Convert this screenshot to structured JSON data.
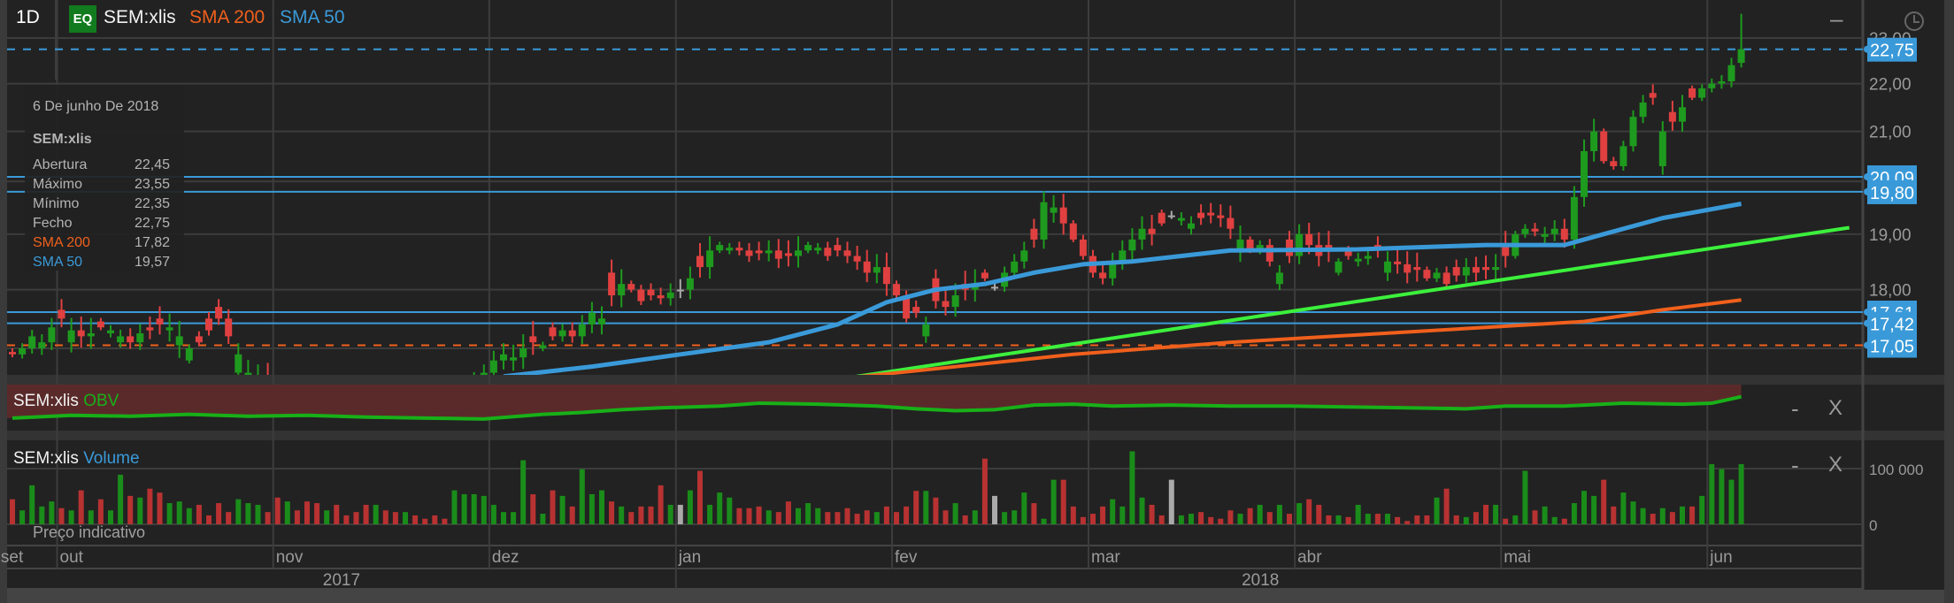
{
  "header": {
    "interval": "1D",
    "badge": "EQ",
    "symbol": "SEM:xlis",
    "sma200_label": "SMA 200",
    "sma50_label": "SMA 50"
  },
  "tooltip": {
    "date": "6 De junho De 2018",
    "symbol": "SEM:xlis",
    "rows": [
      {
        "label": "Abertura",
        "value": "22,45"
      },
      {
        "label": "Máximo",
        "value": "23,55"
      },
      {
        "label": "Mínimo",
        "value": "22,35"
      },
      {
        "label": "Fecho",
        "value": "22,75"
      },
      {
        "label": "SMA 200",
        "value": "17,82"
      },
      {
        "label": "SMA 50",
        "value": "19,57"
      }
    ]
  },
  "panels": {
    "obv": {
      "symbol": "SEM:xlis",
      "name": "OBV",
      "minimize": "-",
      "close": "X"
    },
    "volume": {
      "symbol": "SEM:xlis",
      "name": "Volume",
      "minimize": "-",
      "close": "X"
    },
    "price_minimize": "–"
  },
  "footer_note": "Preço indicativo",
  "colors": {
    "up": "#1e9a1e",
    "down": "#e04040",
    "neutral": "#aaaaaa",
    "sma200": "#f0601c",
    "sma50": "#3a9ad9",
    "trend": "#3cf03c",
    "obv": "#18b018",
    "obv_fill": "#5a2a2a",
    "tag": "#3a9ad9"
  },
  "chart_data": {
    "type": "candlestick",
    "scale": "log",
    "ylim": [
      16.47,
      23.4
    ],
    "y_ticks": [
      {
        "v": 23,
        "label": "23,00"
      },
      {
        "v": 22,
        "label": "22,00"
      },
      {
        "v": 21,
        "label": "21,00"
      },
      {
        "v": 19,
        "label": "19,00"
      },
      {
        "v": 18,
        "label": "18,00"
      }
    ],
    "price_tags": [
      {
        "v": 22.75,
        "label": "22,75",
        "style": "dashed-blue"
      },
      {
        "v": 20.09,
        "label": "20,09",
        "style": "solid-blue"
      },
      {
        "v": 19.8,
        "label": "19,80",
        "style": "solid-blue"
      },
      {
        "v": 17.61,
        "label": "17,61",
        "style": "solid-blue"
      },
      {
        "v": 17.42,
        "label": "17,42",
        "style": "solid-blue"
      },
      {
        "v": 17.05,
        "label": "17,05",
        "style": "dashed-orange"
      }
    ],
    "months": [
      {
        "label": "set",
        "day": -1
      },
      {
        "label": "out",
        "day": 5
      },
      {
        "label": "nov",
        "day": 27
      },
      {
        "label": "dez",
        "day": 49
      },
      {
        "label": "jan",
        "day": 68
      },
      {
        "label": "fev",
        "day": 90
      },
      {
        "label": "mar",
        "day": 110
      },
      {
        "label": "abr",
        "day": 131
      },
      {
        "label": "mai",
        "day": 152
      },
      {
        "label": "jun",
        "day": 173
      }
    ],
    "years": [
      {
        "label": "2017",
        "from": -1,
        "to": 68
      },
      {
        "label": "2018",
        "from": 68,
        "to": 187
      }
    ],
    "close": [
      16.9,
      17.0,
      17.2,
      17.1,
      17.35,
      17.5,
      17.3,
      17.2,
      17.25,
      17.35,
      17.3,
      17.2,
      17.1,
      17.25,
      17.3,
      17.4,
      17.35,
      17.2,
      17.0,
      17.1,
      17.3,
      17.5,
      17.2,
      16.9,
      16.6,
      16.5,
      16.4,
      16.3,
      16.2,
      16.2,
      16.3,
      16.1,
      16.0,
      16.1,
      16.2,
      16.0,
      15.9,
      16.0,
      16.1,
      16.0,
      15.9,
      16.0,
      16.1,
      16.2,
      16.1,
      16.3,
      16.4,
      16.5,
      16.6,
      16.8,
      16.9,
      16.85,
      17.0,
      17.1,
      17.05,
      17.2,
      17.3,
      17.2,
      17.4,
      17.6,
      17.5,
      17.9,
      18.1,
      18.0,
      17.8,
      17.9,
      17.85,
      17.95,
      18.0,
      18.2,
      18.4,
      18.7,
      18.8,
      18.75,
      18.7,
      18.6,
      18.65,
      18.7,
      18.55,
      18.6,
      18.7,
      18.8,
      18.75,
      18.6,
      18.7,
      18.6,
      18.5,
      18.3,
      18.4,
      18.1,
      17.9,
      17.5,
      17.6,
      17.4,
      17.8,
      17.7,
      17.9,
      18.0,
      18.1,
      18.2,
      18.05,
      18.3,
      18.5,
      18.7,
      18.9,
      19.6,
      19.5,
      19.2,
      18.9,
      18.6,
      18.3,
      18.2,
      18.5,
      18.7,
      18.9,
      19.1,
      19.0,
      19.2,
      19.35,
      19.3,
      19.2,
      19.3,
      19.35,
      19.3,
      19.1,
      18.9,
      18.7,
      18.8,
      18.5,
      18.3,
      18.6,
      19.0,
      18.8,
      18.6,
      18.7,
      18.5,
      18.6,
      18.55,
      18.6,
      18.7,
      18.5,
      18.45,
      18.3,
      18.35,
      18.2,
      18.3,
      18.1,
      18.25,
      18.4,
      18.3,
      18.35,
      18.4,
      18.6,
      19.0,
      19.1,
      19.05,
      19.0,
      19.1,
      18.9,
      19.7,
      20.6,
      21.0,
      20.4,
      20.3,
      20.7,
      21.3,
      21.6,
      21.7,
      21.0,
      21.2,
      21.5,
      21.7,
      21.9,
      22.0,
      22.05,
      22.4,
      22.75
    ],
    "last_candle": {
      "open": 22.45,
      "high": 23.55,
      "low": 22.35,
      "close": 22.75
    },
    "direction": "rgggg rgrgrggrgrrgggrrrrgggr rgrrrgrrrrgrrgrrrrgggg gggg rgrgrgggrgrrrr gngrgggrrrgrrgggrrrrrg rrrrgrrgrgrnggg rggrr rrrggggrrnggrrrrgrgrg rgrrrgrggrgrrrrgrrgrr grggrggrgggrrgggrgrgr gggg",
    "volume": [
      45,
      25,
      70,
      32,
      41,
      29,
      25,
      61,
      25,
      45,
      25,
      89,
      51,
      48,
      64,
      57,
      38,
      41,
      29,
      35,
      16,
      38,
      22,
      45,
      38,
      35,
      22,
      48,
      41,
      25,
      41,
      38,
      25,
      35,
      16,
      22,
      35,
      35,
      25,
      22,
      22,
      16,
      10,
      16,
      10,
      61,
      54,
      54,
      51,
      35,
      22,
      22,
      115,
      54,
      19,
      61,
      51,
      32,
      99,
      54,
      61,
      41,
      32,
      22,
      32,
      32,
      70,
      35,
      35,
      61,
      96,
      35,
      57,
      48,
      29,
      29,
      32,
      25,
      22,
      41,
      29,
      38,
      29,
      22,
      22,
      29,
      19,
      25,
      22,
      32,
      22,
      32,
      60,
      60,
      48,
      25,
      38,
      16,
      25,
      118,
      51,
      22,
      25,
      57,
      38,
      10,
      80,
      80,
      32,
      13,
      19,
      32,
      45,
      32,
      131,
      48,
      35,
      16,
      80,
      16,
      19,
      22,
      13,
      10,
      25,
      19,
      29,
      35,
      22,
      35,
      19,
      38,
      45,
      35,
      16,
      16,
      13,
      35,
      19,
      19,
      19,
      13,
      6,
      16,
      16,
      48,
      64,
      16,
      13,
      22,
      35,
      35,
      10,
      16,
      96,
      25,
      32,
      13,
      10,
      38,
      60,
      51,
      80,
      32,
      57,
      41,
      29,
      19,
      29,
      22,
      32,
      32,
      51,
      108,
      99,
      80,
      108
    ],
    "volume_unit": "thousand",
    "volume_ticks": [
      {
        "v": 100,
        "label": "100 000"
      },
      {
        "v": 0,
        "label": "0"
      }
    ],
    "sma50": [
      [
        50,
        16.54
      ],
      [
        59,
        16.7
      ],
      [
        68,
        16.9
      ],
      [
        77,
        17.1
      ],
      [
        84,
        17.4
      ],
      [
        89,
        17.78
      ],
      [
        94,
        18.0
      ],
      [
        99,
        18.1
      ],
      [
        104,
        18.3
      ],
      [
        109,
        18.45
      ],
      [
        114,
        18.5
      ],
      [
        119,
        18.6
      ],
      [
        124,
        18.7
      ],
      [
        137,
        18.72
      ],
      [
        150,
        18.8
      ],
      [
        158,
        18.8
      ],
      [
        162,
        19.0
      ],
      [
        168,
        19.3
      ],
      [
        176,
        19.57
      ]
    ],
    "sma200": [
      [
        84,
        16.5
      ],
      [
        108,
        16.9
      ],
      [
        124,
        17.1
      ],
      [
        150,
        17.35
      ],
      [
        160,
        17.45
      ],
      [
        168,
        17.65
      ],
      [
        176,
        17.82
      ]
    ],
    "trendline": [
      [
        83,
        16.47
      ],
      [
        187,
        19.12
      ]
    ],
    "obv": [
      [
        0,
        3
      ],
      [
        6,
        6
      ],
      [
        12,
        5
      ],
      [
        18,
        7
      ],
      [
        24,
        5
      ],
      [
        30,
        6
      ],
      [
        36,
        4
      ],
      [
        42,
        3
      ],
      [
        48,
        2
      ],
      [
        54,
        7
      ],
      [
        58,
        9
      ],
      [
        62,
        12
      ],
      [
        66,
        14
      ],
      [
        72,
        16
      ],
      [
        76,
        19
      ],
      [
        82,
        18
      ],
      [
        88,
        16
      ],
      [
        92,
        13
      ],
      [
        96,
        11
      ],
      [
        100,
        12
      ],
      [
        104,
        17
      ],
      [
        108,
        18
      ],
      [
        112,
        16
      ],
      [
        118,
        17
      ],
      [
        124,
        16
      ],
      [
        130,
        16
      ],
      [
        136,
        15
      ],
      [
        142,
        14
      ],
      [
        148,
        13
      ],
      [
        152,
        16
      ],
      [
        158,
        16
      ],
      [
        164,
        19
      ],
      [
        170,
        18
      ],
      [
        173,
        19
      ],
      [
        176,
        26
      ]
    ]
  }
}
